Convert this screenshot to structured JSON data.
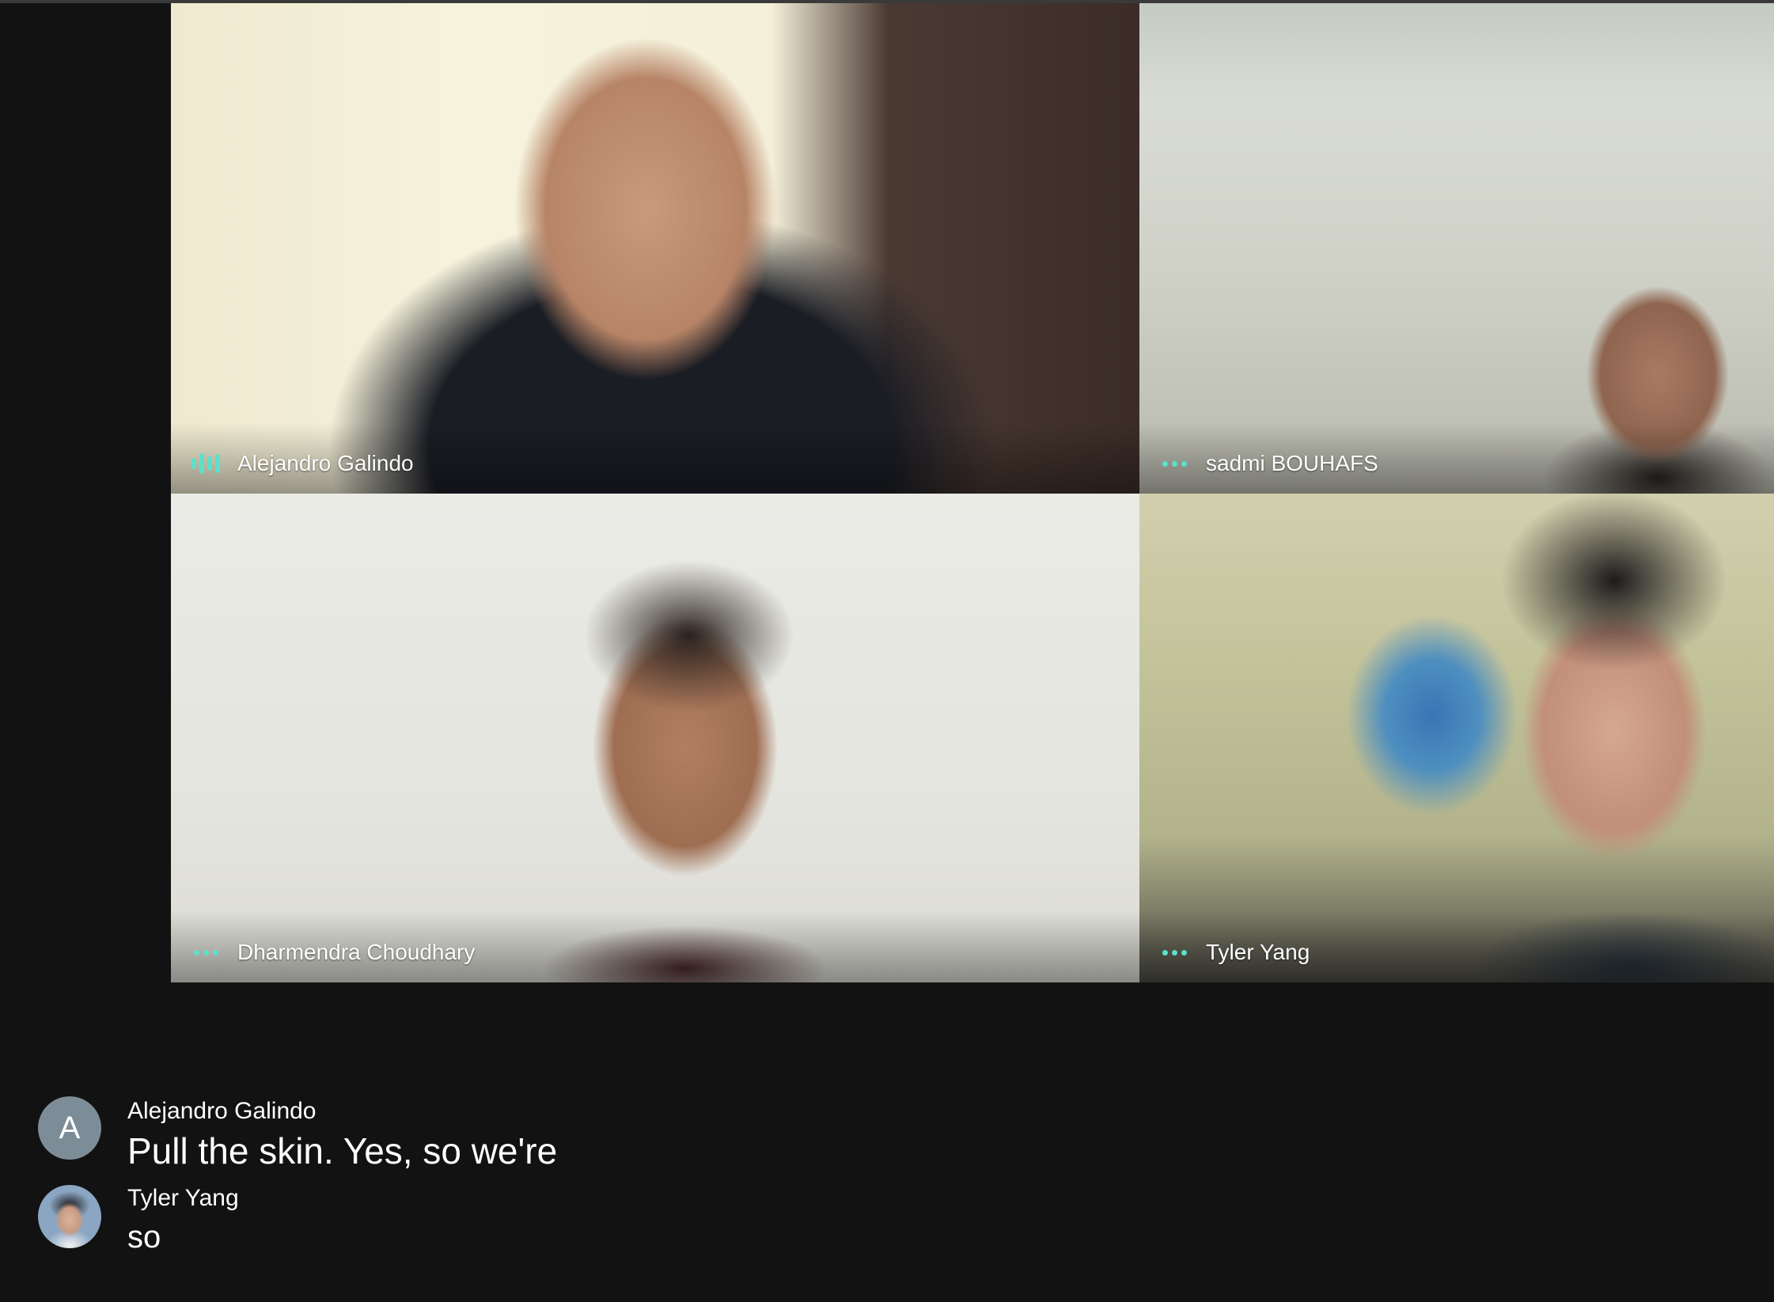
{
  "accent_color": "#5de0c9",
  "participants": [
    {
      "name": "Alejandro Galindo",
      "indicator": "audio-bars-icon"
    },
    {
      "name": "sadmi BOUHAFS",
      "indicator": "more-dots-icon"
    },
    {
      "name": "Dharmendra Choudhary",
      "indicator": "more-dots-icon"
    },
    {
      "name": "Tyler Yang",
      "indicator": "more-dots-icon"
    }
  ],
  "captions": [
    {
      "speaker": "Alejandro Galindo",
      "avatar_letter": "A",
      "text": "Pull the skin. Yes, so we're"
    },
    {
      "speaker": "Tyler Yang",
      "avatar": "profile-photo",
      "text": "so"
    }
  ]
}
